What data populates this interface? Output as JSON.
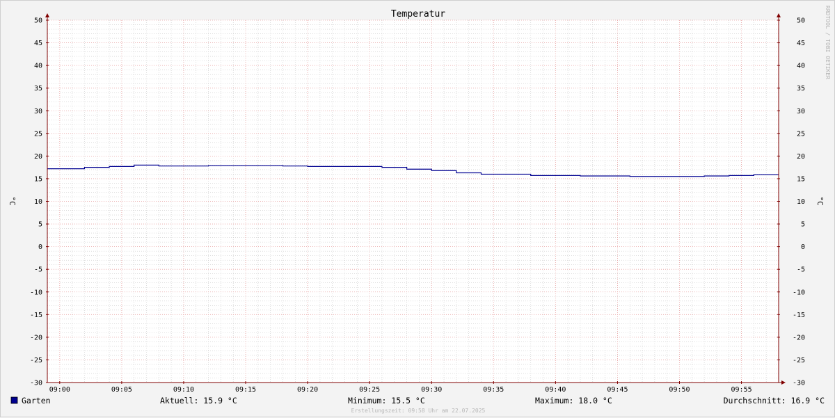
{
  "chart_data": {
    "type": "line",
    "title": "Temperatur",
    "ylabel": "°C",
    "ylabel_right": "°C",
    "ylim": [
      -30,
      50
    ],
    "y_ticks": [
      50,
      45,
      40,
      35,
      30,
      25,
      20,
      15,
      10,
      5,
      0,
      -5,
      -10,
      -15,
      -20,
      -25,
      -30
    ],
    "x_range_min": [
      -1,
      58
    ],
    "x_ticks": [
      {
        "label": "09:00",
        "min": 0
      },
      {
        "label": "09:05",
        "min": 5
      },
      {
        "label": "09:10",
        "min": 10
      },
      {
        "label": "09:15",
        "min": 15
      },
      {
        "label": "09:20",
        "min": 20
      },
      {
        "label": "09:25",
        "min": 25
      },
      {
        "label": "09:30",
        "min": 30
      },
      {
        "label": "09:35",
        "min": 35
      },
      {
        "label": "09:40",
        "min": 40
      },
      {
        "label": "09:45",
        "min": 45
      },
      {
        "label": "09:50",
        "min": 50
      },
      {
        "label": "09:55",
        "min": 55
      }
    ],
    "series": [
      {
        "name": "Garten",
        "color": "#000090",
        "step": true,
        "points": [
          {
            "t": -1,
            "v": 17.2
          },
          {
            "t": 0,
            "v": 17.2
          },
          {
            "t": 1,
            "v": 17.2
          },
          {
            "t": 2,
            "v": 17.5
          },
          {
            "t": 3,
            "v": 17.5
          },
          {
            "t": 4,
            "v": 17.7
          },
          {
            "t": 5,
            "v": 17.7
          },
          {
            "t": 6,
            "v": 18.0
          },
          {
            "t": 7,
            "v": 18.0
          },
          {
            "t": 8,
            "v": 17.8
          },
          {
            "t": 9,
            "v": 17.8
          },
          {
            "t": 10,
            "v": 17.8
          },
          {
            "t": 11,
            "v": 17.8
          },
          {
            "t": 12,
            "v": 17.9
          },
          {
            "t": 13,
            "v": 17.9
          },
          {
            "t": 14,
            "v": 17.9
          },
          {
            "t": 15,
            "v": 17.9
          },
          {
            "t": 16,
            "v": 17.9
          },
          {
            "t": 17,
            "v": 17.9
          },
          {
            "t": 18,
            "v": 17.8
          },
          {
            "t": 19,
            "v": 17.8
          },
          {
            "t": 20,
            "v": 17.7
          },
          {
            "t": 21,
            "v": 17.7
          },
          {
            "t": 22,
            "v": 17.7
          },
          {
            "t": 23,
            "v": 17.7
          },
          {
            "t": 24,
            "v": 17.7
          },
          {
            "t": 25,
            "v": 17.7
          },
          {
            "t": 26,
            "v": 17.5
          },
          {
            "t": 27,
            "v": 17.5
          },
          {
            "t": 28,
            "v": 17.1
          },
          {
            "t": 29,
            "v": 17.1
          },
          {
            "t": 30,
            "v": 16.8
          },
          {
            "t": 31,
            "v": 16.8
          },
          {
            "t": 32,
            "v": 16.3
          },
          {
            "t": 33,
            "v": 16.3
          },
          {
            "t": 34,
            "v": 16.0
          },
          {
            "t": 35,
            "v": 16.0
          },
          {
            "t": 36,
            "v": 16.0
          },
          {
            "t": 37,
            "v": 16.0
          },
          {
            "t": 38,
            "v": 15.7
          },
          {
            "t": 39,
            "v": 15.7
          },
          {
            "t": 40,
            "v": 15.7
          },
          {
            "t": 41,
            "v": 15.7
          },
          {
            "t": 42,
            "v": 15.6
          },
          {
            "t": 43,
            "v": 15.6
          },
          {
            "t": 44,
            "v": 15.6
          },
          {
            "t": 45,
            "v": 15.6
          },
          {
            "t": 46,
            "v": 15.5
          },
          {
            "t": 47,
            "v": 15.5
          },
          {
            "t": 48,
            "v": 15.5
          },
          {
            "t": 49,
            "v": 15.5
          },
          {
            "t": 50,
            "v": 15.5
          },
          {
            "t": 51,
            "v": 15.5
          },
          {
            "t": 52,
            "v": 15.6
          },
          {
            "t": 53,
            "v": 15.6
          },
          {
            "t": 54,
            "v": 15.7
          },
          {
            "t": 55,
            "v": 15.7
          },
          {
            "t": 56,
            "v": 15.9
          },
          {
            "t": 57,
            "v": 15.9
          }
        ]
      }
    ],
    "grid": true,
    "legend_position": "bottom-left"
  },
  "legend": {
    "series_name": "Garten",
    "swatch_color": "#000090",
    "current": "Aktuell: 15.9 °C",
    "minimum": "Minimum: 15.5 °C",
    "maximum": "Maximum: 18.0 °C",
    "average": "Durchschnitt: 16.9 °C"
  },
  "watermark": "RRDTOOL / TOBI OETIKER",
  "credit": "Erstellungszeit: 09:58 Uhr am 22.07.2025",
  "colors": {
    "background": "#f3f3f3",
    "plot_background": "#ffffff",
    "major_grid": "#e8a0a0",
    "minor_grid": "#c8c8c8",
    "axis": "#800000"
  }
}
